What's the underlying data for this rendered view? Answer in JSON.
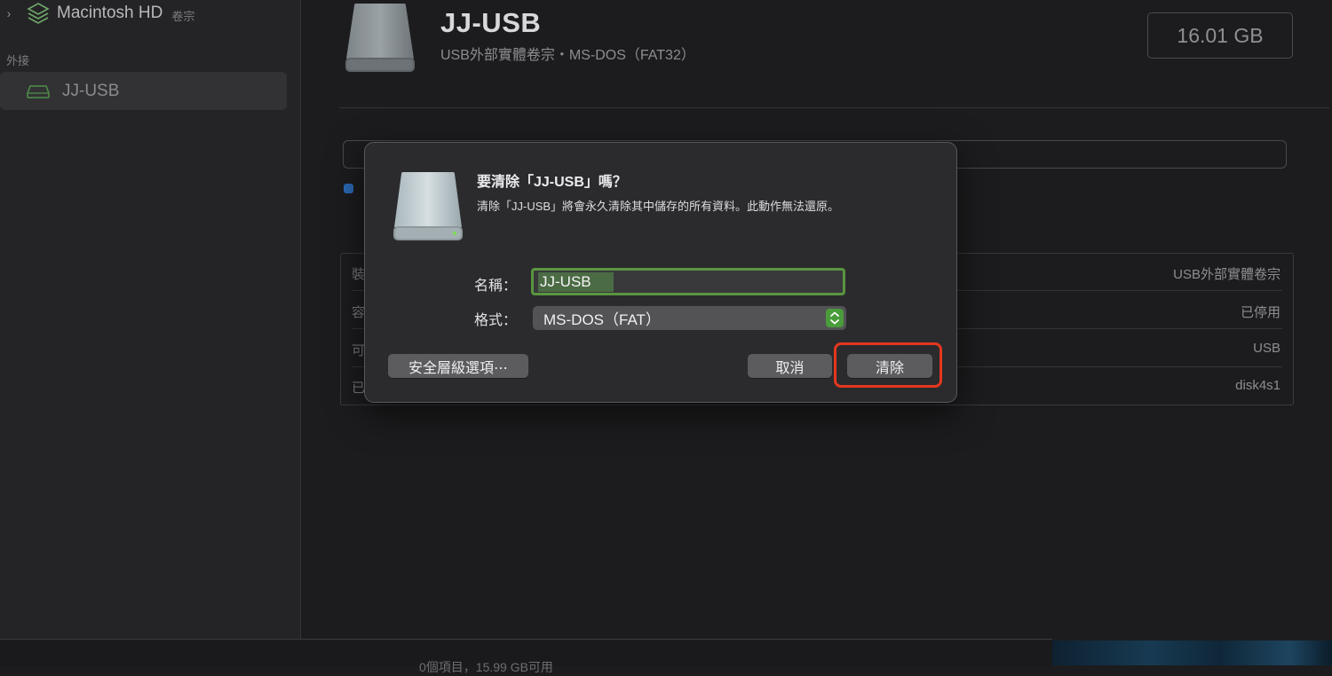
{
  "sidebar": {
    "volume": {
      "chevron": "›",
      "name": "Macintosh HD",
      "subtitle": "卷宗",
      "icon": "layers-icon"
    },
    "section_label": "外接",
    "external": {
      "name": "JJ-USB",
      "icon": "external-drive-icon",
      "selected": true
    }
  },
  "header": {
    "title": "JJ-USB",
    "subtitle": "USB外部實體卷宗・MS-DOS（FAT32）",
    "capacity": "16.01 GB",
    "icon": "external-drive-icon"
  },
  "info_table": {
    "rows": [
      {
        "key": "裝",
        "value": "USB外部實體卷宗"
      },
      {
        "key": "容",
        "value": "已停用"
      },
      {
        "key": "可",
        "value": "USB"
      },
      {
        "key": "已",
        "value": "disk4s1"
      }
    ]
  },
  "status_bar": {
    "text": "0個項目，15.99 GB可用"
  },
  "dialog": {
    "title": "要清除「JJ-USB」嗎？",
    "message": "清除「JJ-USB」將會永久清除其中儲存的所有資料。此動作無法還原。",
    "name_label": "名稱：",
    "name_value": "JJ-USB",
    "format_label": "格式：",
    "format_value": "MS-DOS（FAT）",
    "buttons": {
      "security": "安全層級選項⋯",
      "cancel": "取消",
      "erase": "清除"
    },
    "icon": "external-drive-icon"
  },
  "colors": {
    "background": "#1c1c1e",
    "sidebar": "#242426",
    "dialog": "#2b2b2d",
    "accent_green": "#5a9640",
    "highlight_red": "#e5371f",
    "usage_blue": "#2a69b4"
  }
}
